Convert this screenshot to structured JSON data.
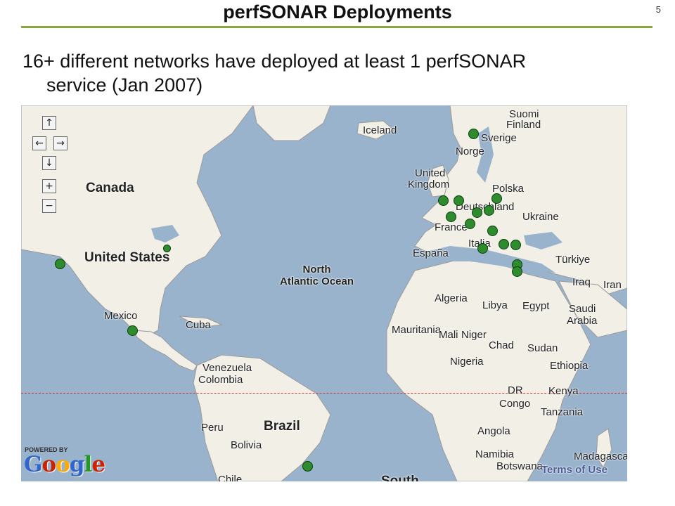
{
  "slide": {
    "title": "perfSONAR Deployments",
    "page_number": "5",
    "bullet_line1": "16+ different networks have deployed at least 1 perfSONAR",
    "bullet_line2": "service (Jan 2007)"
  },
  "map": {
    "labels": {
      "canada": "Canada",
      "united_states": "United States",
      "mexico": "Mexico",
      "cuba": "Cuba",
      "venezuela": "Venezuela",
      "colombia": "Colombia",
      "peru": "Peru",
      "brazil": "Brazil",
      "bolivia": "Bolivia",
      "chile": "Chile",
      "south": "South",
      "iceland": "Iceland",
      "suomi": "Suomi",
      "finland": "Finland",
      "sverige": "Sverige",
      "norge": "Norge",
      "uk_line1": "United",
      "uk_line2": "Kingdom",
      "polska": "Polska",
      "deutschland": "Deutschland",
      "ukraine": "Ukraine",
      "france": "France",
      "italia": "Italia",
      "espana": "España",
      "turkiye": "Türkiye",
      "iraq": "Iraq",
      "iran": "Iran",
      "ocean_line1": "North",
      "ocean_line2": "Atlantic Ocean",
      "algeria": "Algeria",
      "libya": "Libya",
      "egypt": "Egypt",
      "saudi_line1": "Saudi",
      "saudi_line2": "Arabia",
      "mauritania": "Mauritania",
      "mali": "Mali",
      "niger": "Niger",
      "chad": "Chad",
      "sudan": "Sudan",
      "nigeria": "Nigeria",
      "ethiopia": "Ethiopia",
      "dr": "DR",
      "congo": "Congo",
      "kenya": "Kenya",
      "tanzania": "Tanzania",
      "angola": "Angola",
      "namibia": "Namibia",
      "botswana": "Botswana",
      "madagascar": "Madagascar"
    },
    "controls": {
      "pan_up": "↑",
      "pan_left": "←",
      "pan_right": "→",
      "pan_down": "↓",
      "zoom_in": "+",
      "zoom_out": "−"
    },
    "powered_by": "POWERED BY",
    "google_letters": [
      "G",
      "o",
      "o",
      "g",
      "l",
      "e"
    ],
    "terms_of_use": "Terms of Use",
    "colors": {
      "ocean": "#99b3cc",
      "land": "#f2efe6",
      "marker_fill": "#2e8b2e",
      "title_rule": "#8aa63a"
    }
  }
}
